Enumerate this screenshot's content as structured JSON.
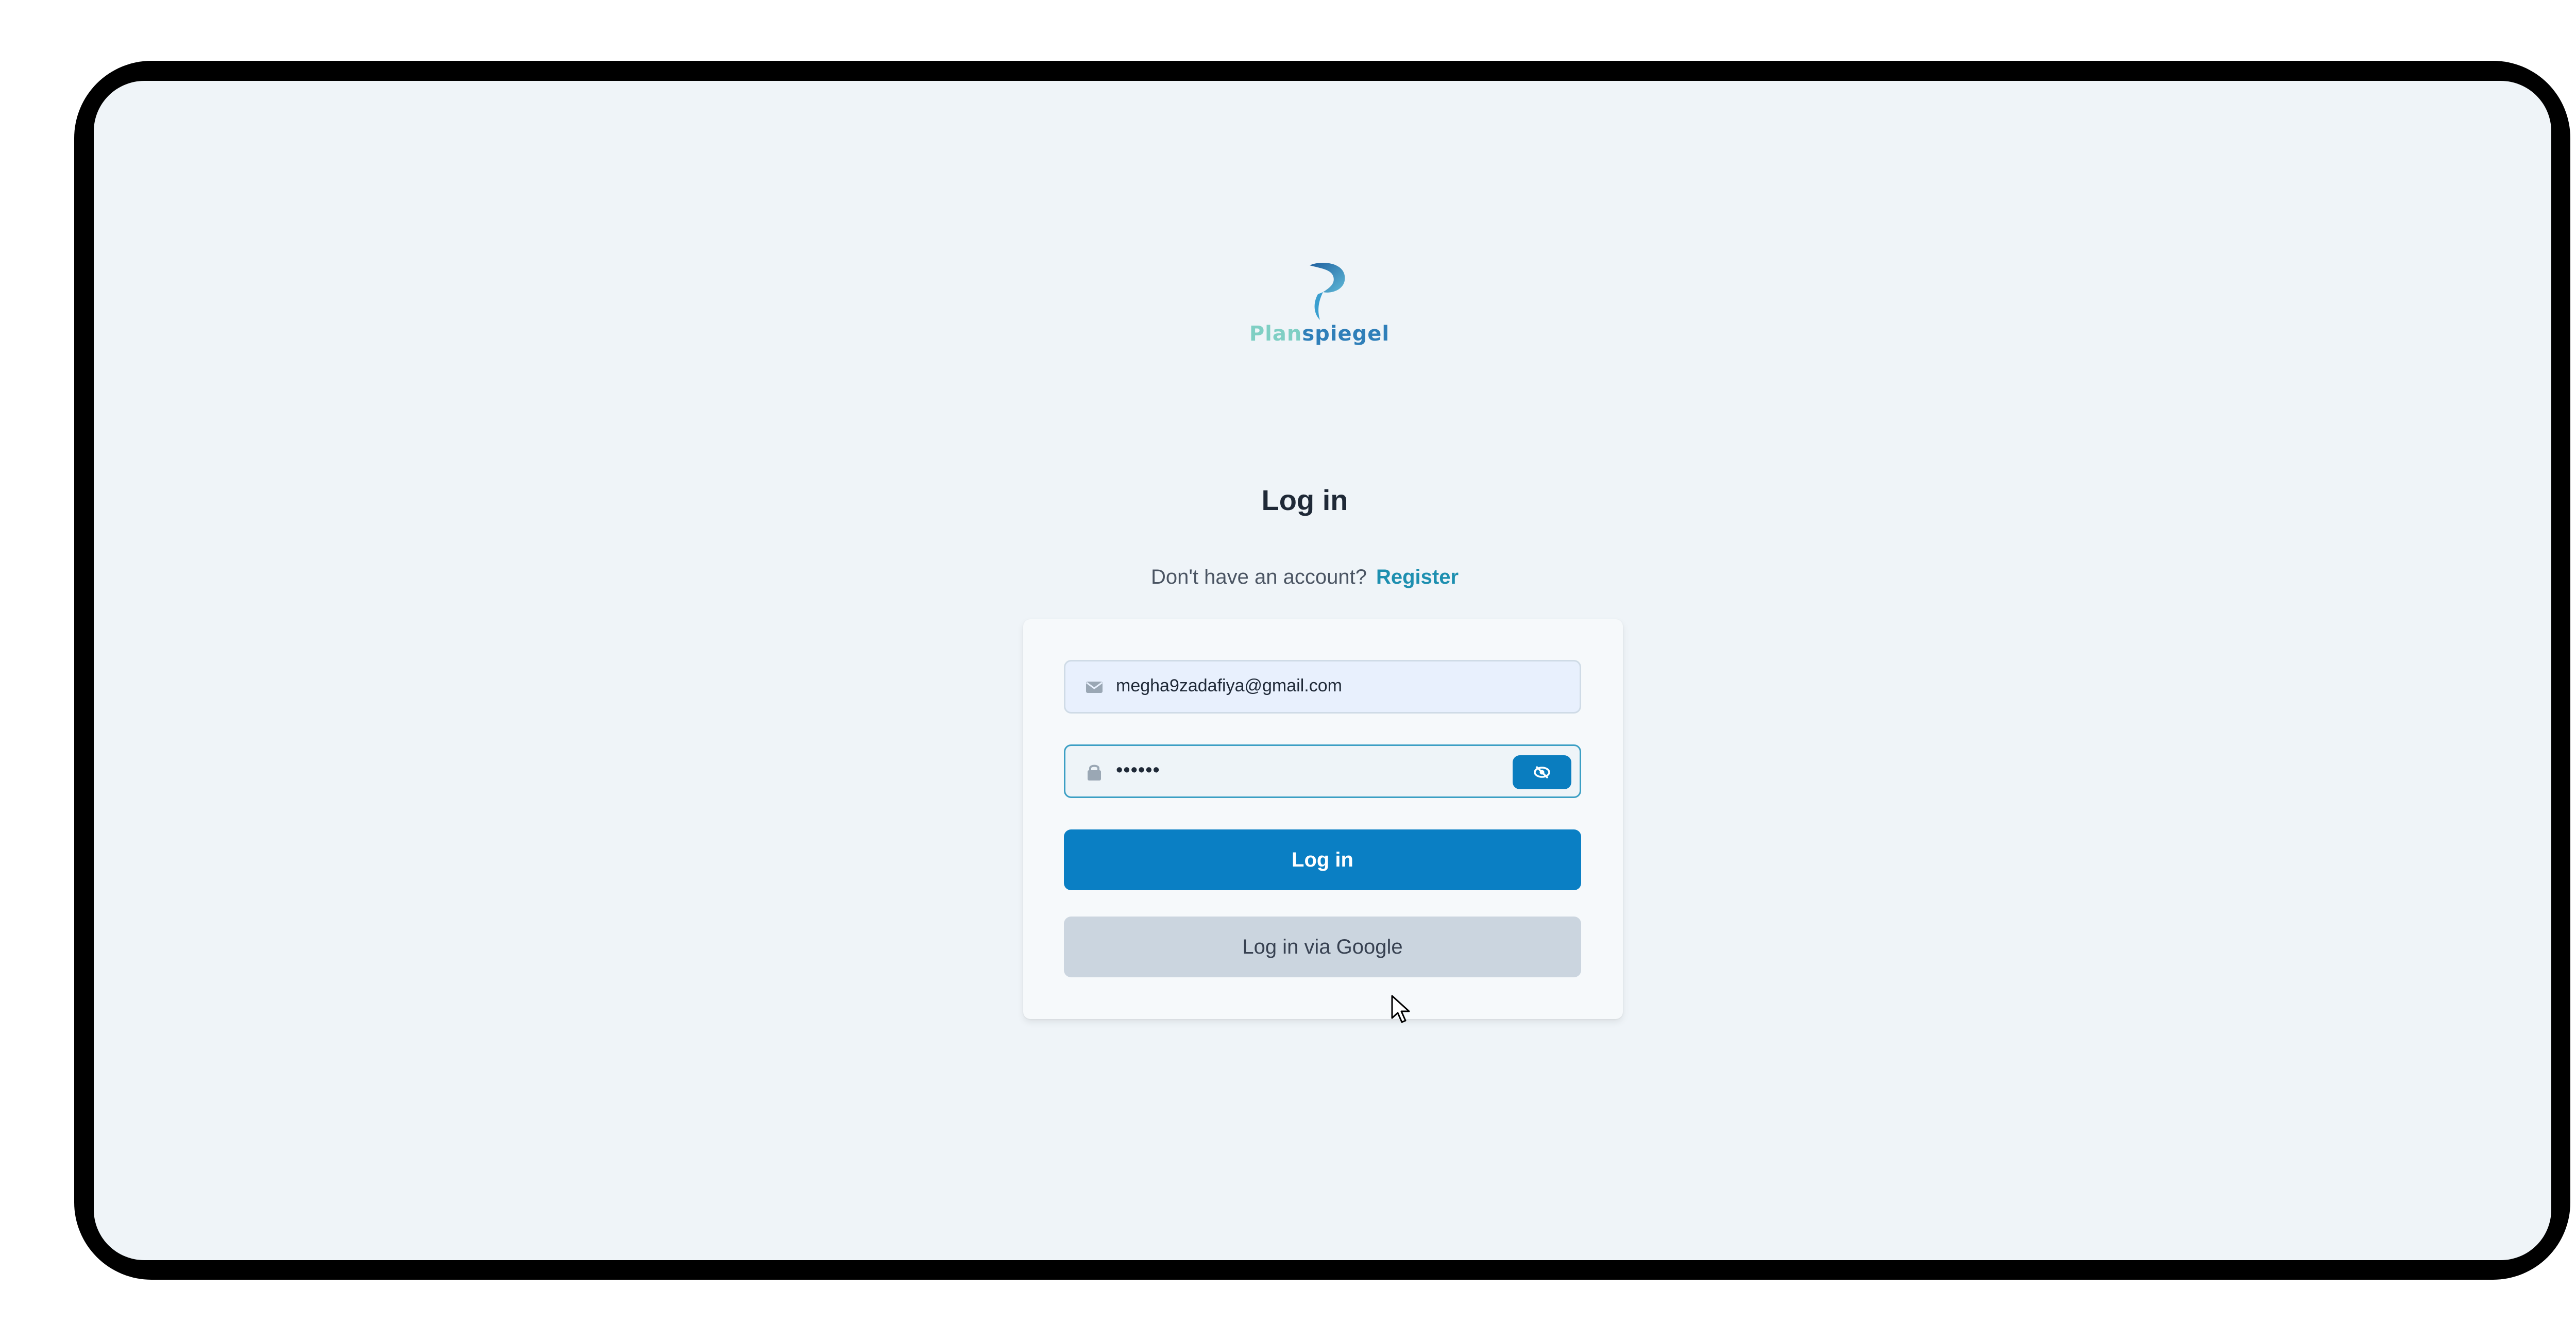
{
  "brand": {
    "name_part_a": "Plan",
    "name_part_b": "spiegel",
    "color_primary": "#2f7fb9",
    "color_secondary": "#7fcfc4"
  },
  "auth": {
    "title": "Log in",
    "no_account_text": "Don't have an account?",
    "register_link": "Register",
    "email_value": "megha9zadafiya@gmail.com",
    "password_value": "••••••",
    "login_button": "Log in",
    "google_button": "Log in via Google"
  },
  "icons": {
    "email": "mail-icon",
    "password": "lock-icon",
    "toggle": "eye-slash-icon"
  },
  "colors": {
    "accent": "#0a7fc4",
    "background": "#eff4f8",
    "link": "#1d8fb0"
  }
}
